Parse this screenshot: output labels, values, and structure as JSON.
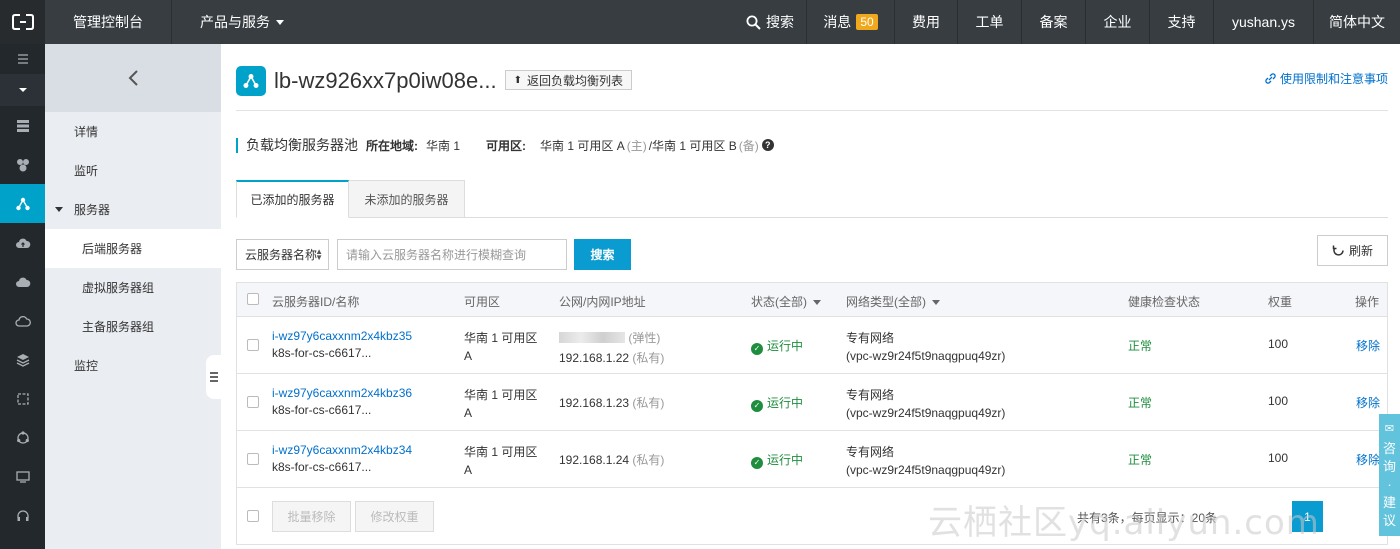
{
  "topbar": {
    "console": "管理控制台",
    "products": "产品与服务",
    "search": "搜索",
    "messages": "消息",
    "messages_count": "50",
    "billing": "费用",
    "tickets": "工单",
    "icp": "备案",
    "enterprise": "企业",
    "support": "支持",
    "user": "yushan.ys",
    "language": "简体中文"
  },
  "rail": {
    "icons": [
      "menu-icon",
      "expand-icon",
      "server-icon",
      "database-icon",
      "slb-icon",
      "cloud-upload-icon",
      "cloud-icon",
      "cloud-outline-icon",
      "layers-icon",
      "cube-icon",
      "network-icon",
      "monitor-icon",
      "headset-icon"
    ],
    "active_index": 4
  },
  "sidebar": {
    "items": [
      {
        "label": "详情",
        "type": "item"
      },
      {
        "label": "监听",
        "type": "item"
      },
      {
        "label": "服务器",
        "type": "group"
      },
      {
        "label": "后端服务器",
        "type": "sub",
        "active": true
      },
      {
        "label": "虚拟服务器组",
        "type": "sub"
      },
      {
        "label": "主备服务器组",
        "type": "sub"
      },
      {
        "label": "监控",
        "type": "item"
      }
    ]
  },
  "header": {
    "title": "lb-wz926xx7p0iw08e...",
    "back_label": "返回负载均衡列表",
    "help_link": "使用限制和注意事项"
  },
  "section": {
    "title": "负载均衡服务器池",
    "region_label": "所在地域:",
    "region_value": "华南 1",
    "zone_label": "可用区:",
    "zone_primary": "华南 1 可用区 A",
    "zone_primary_tag": "(主)",
    "zone_secondary": "/华南 1 可用区 B",
    "zone_secondary_tag": "(备)"
  },
  "tabs": [
    {
      "label": "已添加的服务器",
      "active": true
    },
    {
      "label": "未添加的服务器",
      "active": false
    }
  ],
  "filter": {
    "select_value": "云服务器名称",
    "search_placeholder": "请输入云服务器名称进行模糊查询",
    "search_button": "搜索",
    "refresh_button": "刷新"
  },
  "table": {
    "columns": {
      "id": "云服务器ID/名称",
      "zone": "可用区",
      "ip": "公网/内网IP地址",
      "status": "状态(全部)",
      "network": "网络类型(全部)",
      "health": "健康检查状态",
      "weight": "权重",
      "action": "操作"
    },
    "rows": [
      {
        "id": "i-wz97y6caxxnm2x4kbz35",
        "name": "k8s-for-cs-c6617...",
        "zone_line1": "华南 1 可用区",
        "zone_line2": "A",
        "public_ip_tag": "(弹性)",
        "private_ip": "192.168.1.22",
        "private_ip_tag": "(私有)",
        "status": "运行中",
        "network_line1": "专有网络",
        "network_line2": "(vpc-wz9r24f5t9naqgpuq49zr)",
        "health": "正常",
        "weight": "100",
        "action": "移除"
      },
      {
        "id": "i-wz97y6caxxnm2x4kbz36",
        "name": "k8s-for-cs-c6617...",
        "zone_line1": "华南 1 可用区",
        "zone_line2": "A",
        "private_ip": "192.168.1.23",
        "private_ip_tag": "(私有)",
        "status": "运行中",
        "network_line1": "专有网络",
        "network_line2": "(vpc-wz9r24f5t9naqgpuq49zr)",
        "health": "正常",
        "weight": "100",
        "action": "移除"
      },
      {
        "id": "i-wz97y6caxxnm2x4kbz34",
        "name": "k8s-for-cs-c6617...",
        "zone_line1": "华南 1 可用区",
        "zone_line2": "A",
        "private_ip": "192.168.1.24",
        "private_ip_tag": "(私有)",
        "status": "运行中",
        "network_line1": "专有网络",
        "network_line2": "(vpc-wz9r24f5t9naqgpuq49zr)",
        "health": "正常",
        "weight": "100",
        "action": "移除"
      }
    ],
    "footer": {
      "batch_remove": "批量移除",
      "edit_weight": "修改权重",
      "summary": "共有3条，每页显示：20条",
      "page": "1"
    }
  },
  "watermark": "云栖社区yq.aliyun.com",
  "float_tab": [
    "咨",
    "询",
    "·",
    "建",
    "议"
  ],
  "colors": {
    "topbar": "#373d41",
    "accent": "#00a2ca",
    "link": "#0070cc",
    "ok": "#1e8e3e"
  }
}
